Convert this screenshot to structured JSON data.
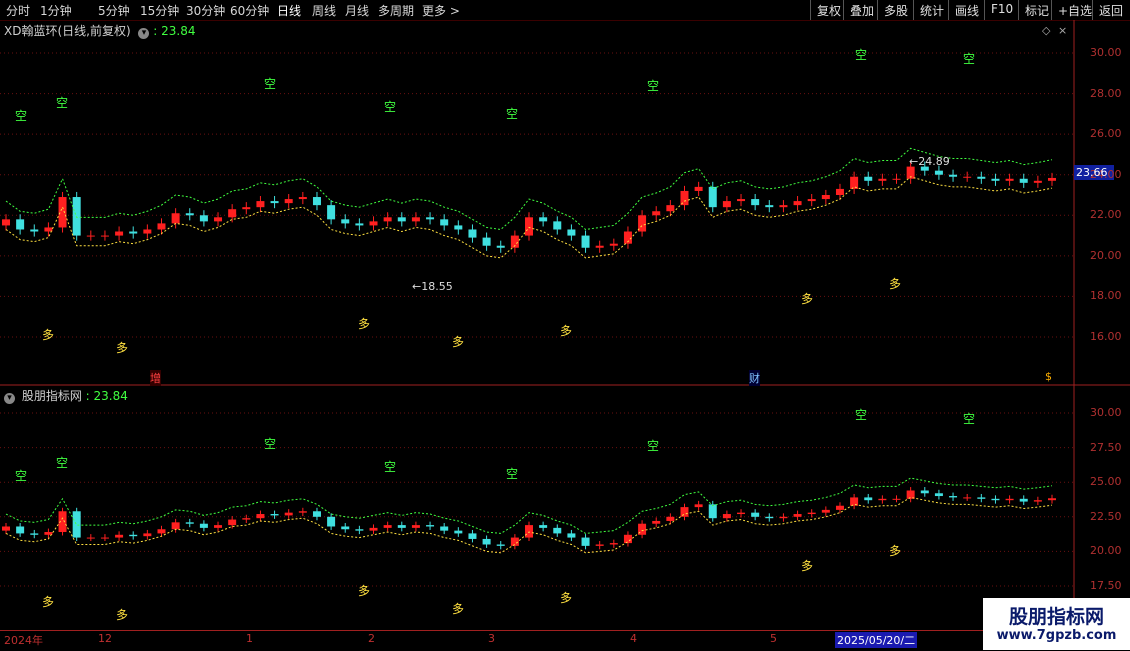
{
  "toolbar": {
    "left": [
      "分时",
      "1分钟",
      "5分钟",
      "15分钟",
      "30分钟",
      "60分钟",
      "日线",
      "周线",
      "月线",
      "多周期",
      "更多 >"
    ],
    "active": "日线",
    "right": [
      "复权",
      "叠加",
      "多股",
      "统计",
      "画线",
      "F10",
      "标记",
      "+自选",
      "返回"
    ]
  },
  "upper_panel": {
    "title": "XD翰蓝环(日线,前复权)",
    "value_label": "23.84",
    "current_price": "23.66",
    "high_marker": "24.89",
    "low_marker": "18.55",
    "event_marks": [
      "增",
      "财",
      "$"
    ],
    "y_ticks": [
      "30.00",
      "28.00",
      "26.00",
      "24.00",
      "22.00",
      "20.00",
      "18.00",
      "16.00"
    ]
  },
  "lower_panel": {
    "title": "股朋指标网",
    "value_label": "23.84",
    "y_ticks": [
      "30.00",
      "27.50",
      "25.00",
      "22.50",
      "20.00",
      "17.50"
    ]
  },
  "signals": {
    "short": "空",
    "long": "多"
  },
  "date_axis": {
    "labels": [
      "2024年",
      "12",
      "1",
      "2",
      "3",
      "4",
      "5"
    ],
    "selected": "2025/05/20/二"
  },
  "watermark": {
    "line1": "股朋指标网",
    "line2": "www.7gpzb.com"
  },
  "colors": {
    "up": "#ff2020",
    "down": "#40e0e0",
    "grid": "#6a1010",
    "short": "#40ff40",
    "long": "#ffe040"
  },
  "chart_data": {
    "type": "candlestick",
    "series": [
      {
        "name": "close",
        "values": [
          21.8,
          21.3,
          21.2,
          21.4,
          22.9,
          21.0,
          21.0,
          21.0,
          21.2,
          21.1,
          21.3,
          21.6,
          22.1,
          22.0,
          21.7,
          21.9,
          22.3,
          22.4,
          22.7,
          22.6,
          22.8,
          22.9,
          22.5,
          21.8,
          21.6,
          21.5,
          21.7,
          21.9,
          21.7,
          21.9,
          21.8,
          21.5,
          21.3,
          20.9,
          20.5,
          20.4,
          21.0,
          21.9,
          21.7,
          21.3,
          21.0,
          20.4,
          20.5,
          20.6,
          21.2,
          22.0,
          22.2,
          22.5,
          23.2,
          23.4,
          22.4,
          22.7,
          22.8,
          22.5,
          22.4,
          22.5,
          22.7,
          22.8,
          23.0,
          23.3,
          23.9,
          23.7,
          23.8,
          23.8,
          24.4,
          24.2,
          24.0,
          23.9,
          23.9,
          23.8,
          23.7,
          23.8,
          23.6,
          23.7,
          23.84
        ]
      }
    ]
  }
}
